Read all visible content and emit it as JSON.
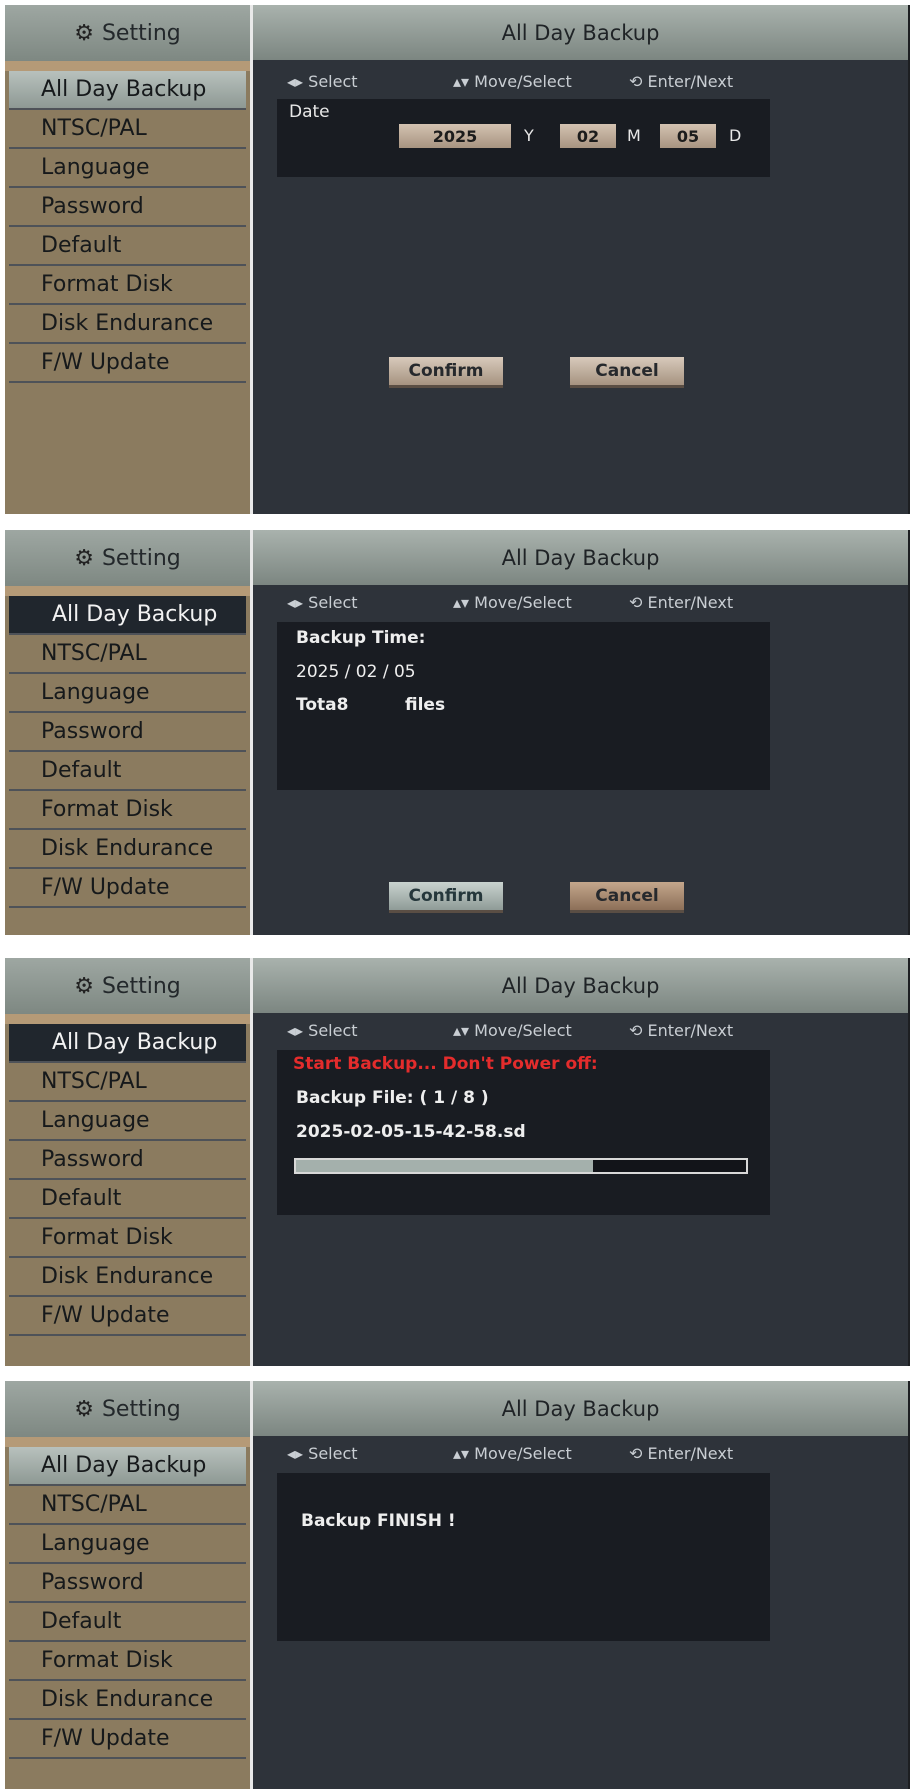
{
  "sidebar": {
    "title": "Setting",
    "items": [
      "All Day Backup",
      "NTSC/PAL",
      "Language",
      "Password",
      "Default",
      "Format Disk",
      "Disk Endurance",
      "F/W Update"
    ]
  },
  "header": {
    "title": "All Day Backup"
  },
  "hints": {
    "select": "Select",
    "move": "Move/Select",
    "enter": "Enter/Next"
  },
  "screen1": {
    "date_label": "Date",
    "year": "2025",
    "year_unit": "Y",
    "month": "02",
    "month_unit": "M",
    "day": "05",
    "day_unit": "D",
    "confirm": "Confirm",
    "cancel": "Cancel"
  },
  "screen2": {
    "backup_time_label": "Backup Time:",
    "backup_date": "2025 / 02 / 05",
    "total_text": "Tota8",
    "files_text": "files",
    "confirm": "Confirm",
    "cancel": "Cancel"
  },
  "screen3": {
    "warning": "Start Backup... Don't Power off:",
    "backup_file": "Backup File:  ( 1 / 8 )",
    "file_name": "2025-02-05-15-42-58.sd",
    "progress": 0.66
  },
  "screen4": {
    "finish": "Backup FINISH !"
  },
  "colors": {
    "sidebar_bg": "#8b7b5f",
    "content_bg": "#2e333a",
    "box_bg": "#191c22",
    "warning": "#e42c2c"
  }
}
